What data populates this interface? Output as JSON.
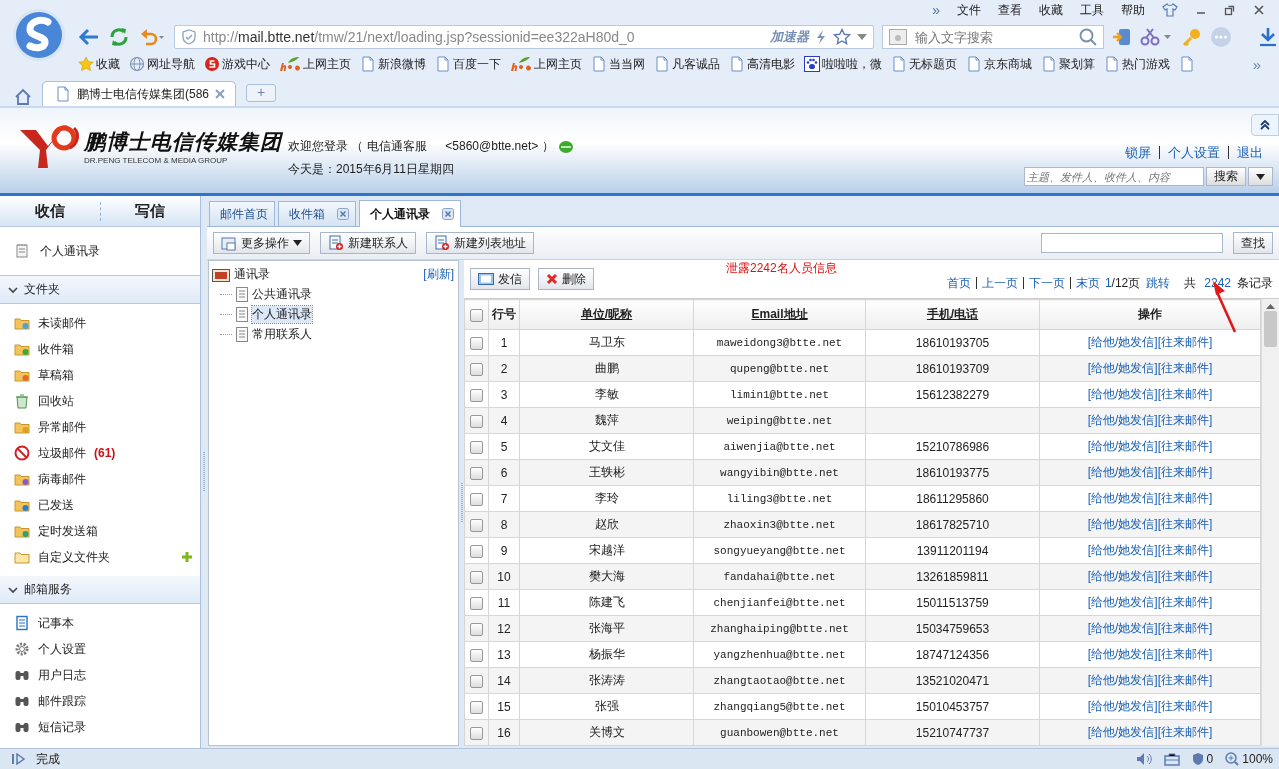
{
  "browser": {
    "menu_more": "»",
    "menu": [
      "文件",
      "查看",
      "收藏",
      "工具",
      "帮助"
    ],
    "address": {
      "scheme": "http://",
      "host": "mail.btte.net",
      "path": "/tmw/21/next/loading.jsp?sessionid=ee322aH80d_0"
    },
    "accelerator": "加速器",
    "search": {
      "placeholder": "输入文字搜索"
    },
    "bookmarks": [
      {
        "label": "收藏",
        "kind": "star"
      },
      {
        "label": "网址导航",
        "kind": "globe"
      },
      {
        "label": "游戏中心",
        "kind": "game"
      },
      {
        "label": "上网主页",
        "kind": "hao"
      },
      {
        "label": "新浪微博",
        "kind": "page"
      },
      {
        "label": "百度一下",
        "kind": "page"
      },
      {
        "label": "上网主页",
        "kind": "hao"
      },
      {
        "label": "当当网",
        "kind": "page"
      },
      {
        "label": "凡客诚品",
        "kind": "page"
      },
      {
        "label": "高清电影",
        "kind": "page"
      },
      {
        "label": "啦啦啦，微",
        "kind": "paw"
      },
      {
        "label": "无标题页",
        "kind": "page"
      },
      {
        "label": "京东商城",
        "kind": "page"
      },
      {
        "label": "聚划算",
        "kind": "page"
      },
      {
        "label": "热门游戏",
        "kind": "page"
      },
      {
        "kind": "page"
      }
    ],
    "bookmarks_more": "»",
    "tabs": [
      {
        "label": "鹏博士电信传媒集团(586",
        "selected": true
      }
    ],
    "new_tab": "+"
  },
  "header": {
    "logo": {
      "name": "鹏博士电信传媒集团",
      "subtitle": "DR.PENG TELECOM & MEDIA GROUP"
    },
    "welcome": "欢迎您登录 （ 电信通客服 　 <5860@btte.net> ）",
    "date": "今天是：2015年6月11日星期四",
    "links": [
      "锁屏",
      "个人设置",
      "退出"
    ],
    "search": {
      "placeholder": "主题、发件人、收件人、内容",
      "button": "搜索"
    }
  },
  "sidebar": {
    "tabs": [
      "收信",
      "写信"
    ],
    "top_item": "个人通讯录",
    "sections": [
      {
        "title": "文件夹",
        "expanded": true,
        "items": [
          {
            "label": "未读邮件",
            "kind": "unread"
          },
          {
            "label": "收件箱",
            "kind": "inbox"
          },
          {
            "label": "草稿箱",
            "kind": "draft"
          },
          {
            "label": "回收站",
            "kind": "trash"
          },
          {
            "label": "异常邮件",
            "kind": "error"
          },
          {
            "label": "垃圾邮件",
            "kind": "spam",
            "count": "(61)"
          },
          {
            "label": "病毒邮件",
            "kind": "virus"
          },
          {
            "label": "已发送",
            "kind": "sent"
          },
          {
            "label": "定时发送箱",
            "kind": "timer"
          },
          {
            "label": "自定义文件夹",
            "kind": "custom",
            "addable": true
          }
        ]
      },
      {
        "title": "邮箱服务",
        "expanded": true,
        "items": [
          {
            "label": "记事本",
            "kind": "notepad"
          },
          {
            "label": "个人设置",
            "kind": "gear"
          },
          {
            "label": "用户日志",
            "kind": "binoculars"
          },
          {
            "label": "邮件跟踪",
            "kind": "binoculars"
          },
          {
            "label": "短信记录",
            "kind": "binoculars"
          }
        ]
      }
    ]
  },
  "main": {
    "tabs": [
      {
        "label": "邮件首页",
        "closable": false,
        "selected": false
      },
      {
        "label": "收件箱",
        "closable": true,
        "selected": false
      },
      {
        "label": "个人通讯录",
        "closable": true,
        "selected": true
      }
    ],
    "toolbar": [
      {
        "label": "更多操作",
        "kind": "menu"
      },
      {
        "label": "新建联系人",
        "kind": "add"
      },
      {
        "label": "新建列表地址",
        "kind": "add"
      }
    ],
    "find_button": "查找",
    "tree": {
      "label": "通讯录",
      "refresh": "[刷新]",
      "children": [
        {
          "label": "公共通讯录",
          "selected": false
        },
        {
          "label": "个人通讯录",
          "selected": true
        },
        {
          "label": "常用联系人",
          "selected": false
        }
      ]
    },
    "actions": [
      {
        "label": "发信",
        "kind": "send"
      },
      {
        "label": "删除",
        "kind": "delete"
      }
    ],
    "notice": "泄露2242名人员信息",
    "pagination": {
      "links": [
        "首页",
        "上一页",
        "下一页",
        "末页"
      ],
      "page_current": "1",
      "page_total": "/12页",
      "jump": "跳转",
      "total_prefix": "共",
      "total": "2242",
      "total_suffix": "条记录"
    },
    "table": {
      "columns": [
        "行号",
        "单位/昵称",
        "Email地址",
        "手机/电话",
        "操作"
      ],
      "all_checked": false,
      "rows": [
        {
          "no": "1",
          "name": "马卫东",
          "email": "maweidong3@btte.net",
          "phone": "18610193705",
          "actions": [
            "[给他/她发信]",
            "[往来邮件]"
          ],
          "checked": false
        },
        {
          "no": "2",
          "name": "曲鹏",
          "email": "qupeng@btte.net",
          "phone": "18610193709",
          "actions": [
            "[给他/她发信]",
            "[往来邮件]"
          ],
          "checked": false
        },
        {
          "no": "3",
          "name": "李敏",
          "email": "limin1@btte.net",
          "phone": "15612382279",
          "actions": [
            "[给他/她发信]",
            "[往来邮件]"
          ],
          "checked": false
        },
        {
          "no": "4",
          "name": "魏萍",
          "email": "weiping@btte.net",
          "actions": [
            "[给他/她发信]",
            "[往来邮件]"
          ],
          "checked": false
        },
        {
          "no": "5",
          "name": "艾文佳",
          "email": "aiwenjia@btte.net",
          "phone": "15210786986",
          "actions": [
            "[给他/她发信]",
            "[往来邮件]"
          ],
          "checked": false
        },
        {
          "no": "6",
          "name": "王轶彬",
          "email": "wangyibin@btte.net",
          "phone": "18610193775",
          "actions": [
            "[给他/她发信]",
            "[往来邮件]"
          ],
          "checked": false
        },
        {
          "no": "7",
          "name": "李玲",
          "email": "liling3@btte.net",
          "phone": "18611295860",
          "actions": [
            "[给他/她发信]",
            "[往来邮件]"
          ],
          "checked": false
        },
        {
          "no": "8",
          "name": "赵欣",
          "email": "zhaoxin3@btte.net",
          "phone": "18617825710",
          "actions": [
            "[给他/她发信]",
            "[往来邮件]"
          ],
          "checked": false
        },
        {
          "no": "9",
          "name": "宋越洋",
          "email": "songyueyang@btte.net",
          "phone": "13911201194",
          "actions": [
            "[给他/她发信]",
            "[往来邮件]"
          ],
          "checked": false
        },
        {
          "no": "10",
          "name": "樊大海",
          "email": "fandahai@btte.net",
          "phone": "13261859811",
          "actions": [
            "[给他/她发信]",
            "[往来邮件]"
          ],
          "checked": false
        },
        {
          "no": "11",
          "name": "陈建飞",
          "email": "chenjianfei@btte.net",
          "phone": "15011513759",
          "actions": [
            "[给他/她发信]",
            "[往来邮件]"
          ],
          "checked": false
        },
        {
          "no": "12",
          "name": "张海平",
          "email": "zhanghaiping@btte.net",
          "phone": "15034759653",
          "actions": [
            "[给他/她发信]",
            "[往来邮件]"
          ],
          "checked": false
        },
        {
          "no": "13",
          "name": "杨振华",
          "email": "yangzhenhua@btte.net",
          "phone": "18747124356",
          "actions": [
            "[给他/她发信]",
            "[往来邮件]"
          ],
          "checked": false
        },
        {
          "no": "14",
          "name": "张涛涛",
          "email": "zhangtaotao@btte.net",
          "phone": "13521020471",
          "actions": [
            "[给他/她发信]",
            "[往来邮件]"
          ],
          "checked": false
        },
        {
          "no": "15",
          "name": "张强",
          "email": "zhangqiang5@btte.net",
          "phone": "15010453757",
          "actions": [
            "[给他/她发信]",
            "[往来邮件]"
          ],
          "checked": false
        },
        {
          "no": "16",
          "name": "关博文",
          "email": "guanbowen@btte.net",
          "phone": "15210747737",
          "actions": [
            "[给他/她发信]",
            "[往来邮件]"
          ],
          "checked": false
        }
      ]
    }
  },
  "status_bar": {
    "text": "完成",
    "ad_count": "0",
    "zoom": "100%"
  }
}
